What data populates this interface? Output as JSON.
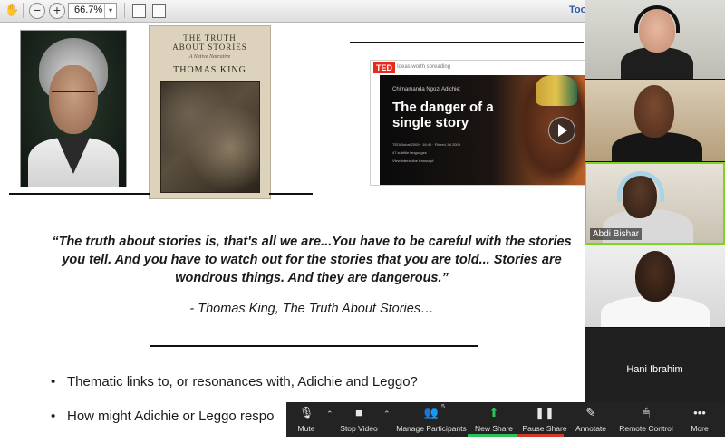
{
  "toolbar": {
    "zoom_out_glyph": "−",
    "zoom_in_glyph": "+",
    "zoom_value": "66.7%",
    "zoom_dropdown_glyph": "▾",
    "tools_label": "Too"
  },
  "book": {
    "title": "THE TRUTH\nABOUT STORIES",
    "subtitle": "A Native Narrative",
    "author": "THOMAS KING"
  },
  "ted": {
    "logo": "TED",
    "tagline": "Ideas worth spreading",
    "speaker": "Chimamanda Ngozi Adichie:",
    "talk_title": "The danger of a single story",
    "meta_line1": "TEDGlobal 2009 · 18:49 · Filmed Jul 2009",
    "meta_line2": "47 subtitle languages",
    "meta_line3": "View interactive transcript"
  },
  "slide": {
    "quote": "“The truth about stories is, that's all we are...You have to be careful with the stories you tell. And you have to watch out for the stories that you are told... Stories are wondrous things. And they are dangerous.”",
    "attribution": "- Thomas King, The Truth About Stories…",
    "bullets": [
      "Thematic links to, or resonances with, Adichie and Leggo?",
      "How might Adichie or Leggo respo"
    ]
  },
  "gallery": {
    "participants": [
      {
        "name": ""
      },
      {
        "name": ""
      },
      {
        "name": "Abdi Bishar"
      },
      {
        "name": ""
      },
      {
        "name": "Hani Ibrahim"
      }
    ]
  },
  "controls": {
    "mute": {
      "label": "Mute",
      "icon": "microphone-icon"
    },
    "stop_video": {
      "label": "Stop Video",
      "icon": "camera-icon"
    },
    "participants": {
      "label": "Manage Participants",
      "count": "5",
      "icon": "people-icon"
    },
    "new_share": {
      "label": "New Share",
      "icon": "share-icon"
    },
    "pause_share": {
      "label": "Pause Share",
      "icon": "pause-icon"
    },
    "annotate": {
      "label": "Annotate",
      "icon": "pencil-icon"
    },
    "remote_control": {
      "label": "Remote Control",
      "icon": "mouse-icon"
    },
    "more": {
      "label": "More",
      "icon": "ellipsis-icon"
    }
  },
  "colors": {
    "share_green": "#2ec05a",
    "ted_red": "#e62b1e",
    "active_speaker": "#7ed321"
  }
}
